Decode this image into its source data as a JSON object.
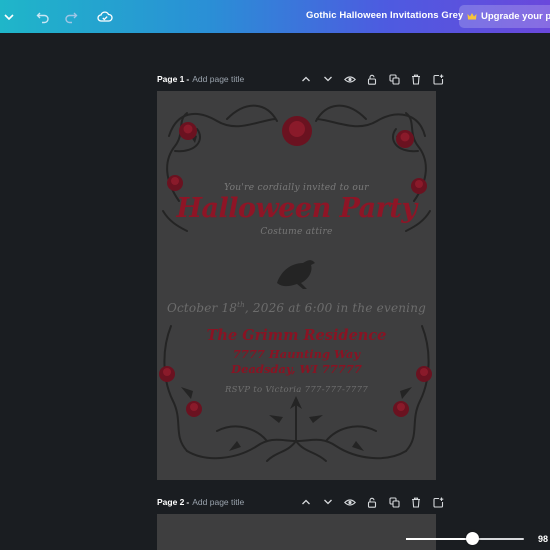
{
  "topbar": {
    "doc_title": "Gothic Halloween Invitations Grey",
    "upgrade_label": "Upgrade your plan",
    "icons": [
      "chevron-down-icon",
      "undo-icon",
      "redo-icon",
      "cloud-saved-icon",
      "crown-icon"
    ]
  },
  "pages": [
    {
      "label": "Page 1",
      "title_placeholder": "Add page title"
    },
    {
      "label": "Page 2",
      "title_placeholder": "Add page title"
    }
  ],
  "page_tools": [
    "chevron-up-icon",
    "chevron-down-icon",
    "eye-icon",
    "lock-icon",
    "duplicate-icon",
    "trash-icon",
    "add-page-icon"
  ],
  "invitation": {
    "cordially": "You're cordially invited to our",
    "headline": "Halloween Party",
    "attire": "Costume attire",
    "date_pre": "October 18",
    "date_sup": "th",
    "date_post": ", 2026 at 6:00 in the evening",
    "venue": "The Grimm Residence",
    "street": "7777 Haunting Way",
    "city": "Deadsday, WI 77777",
    "rsvp": "RSVP to Victoria 777-777-7777"
  },
  "zoom": {
    "value_text": "98",
    "level": 0.56
  },
  "colors": {
    "accent_gradient_start": "#1fb6c9",
    "accent_gradient_end": "#6a48dc",
    "headline_red": "#8e1526",
    "canvas_bg": "#1a1d21",
    "page_bg": "#3e3e3f"
  }
}
